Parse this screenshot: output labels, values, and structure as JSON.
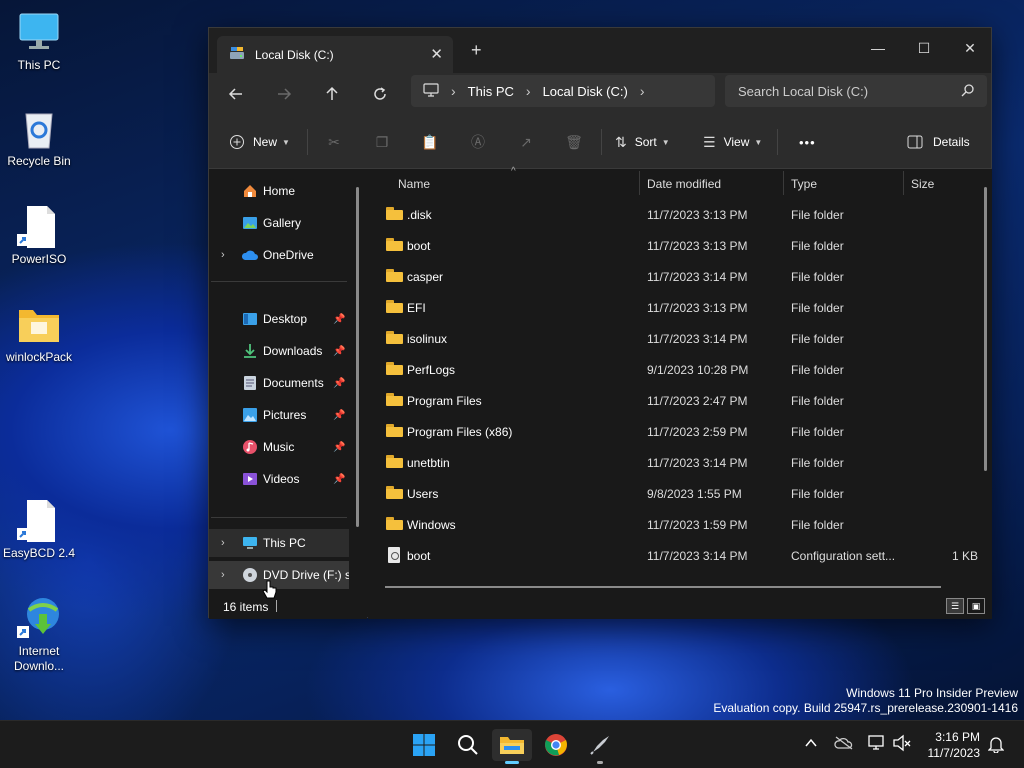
{
  "desktop": {
    "icons": [
      {
        "label": "This PC",
        "icon": "monitor-icon"
      },
      {
        "label": "Recycle Bin",
        "icon": "recycle-bin-icon"
      },
      {
        "label": "PowerISO",
        "icon": "file-shortcut-icon"
      },
      {
        "label": "winlockPack",
        "icon": "folder-icon"
      },
      {
        "label": "EasyBCD 2.4",
        "icon": "file-shortcut-icon"
      },
      {
        "label": "Internet",
        "label2": "Downlo...",
        "icon": "idm-icon"
      }
    ],
    "watermark": {
      "line1": "Windows 11 Pro Insider Preview",
      "line2": "Evaluation copy. Build 25947.rs_prerelease.230901-1416"
    }
  },
  "explorer": {
    "tab_title": "Local Disk (C:)",
    "breadcrumb": [
      "This PC",
      "Local Disk (C:)"
    ],
    "search_placeholder": "Search Local Disk (C:)",
    "toolbar": {
      "new_label": "New",
      "sort_label": "Sort",
      "view_label": "View",
      "more_label": "•••",
      "details_label": "Details"
    },
    "nav": {
      "home": "Home",
      "gallery": "Gallery",
      "onedrive": "OneDrive",
      "desktop": "Desktop",
      "downloads": "Downloads",
      "documents": "Documents",
      "pictures": "Pictures",
      "music": "Music",
      "videos": "Videos",
      "thispc": "This PC",
      "dvd": "DVD Drive (F:) sl"
    },
    "columns": {
      "name": "Name",
      "date": "Date modified",
      "type": "Type",
      "size": "Size"
    },
    "rows": [
      {
        "name": ".disk",
        "date": "11/7/2023 3:13 PM",
        "type": "File folder",
        "size": ""
      },
      {
        "name": "boot",
        "date": "11/7/2023 3:13 PM",
        "type": "File folder",
        "size": ""
      },
      {
        "name": "casper",
        "date": "11/7/2023 3:14 PM",
        "type": "File folder",
        "size": ""
      },
      {
        "name": "EFI",
        "date": "11/7/2023 3:13 PM",
        "type": "File folder",
        "size": ""
      },
      {
        "name": "isolinux",
        "date": "11/7/2023 3:14 PM",
        "type": "File folder",
        "size": ""
      },
      {
        "name": "PerfLogs",
        "date": "9/1/2023 10:28 PM",
        "type": "File folder",
        "size": ""
      },
      {
        "name": "Program Files",
        "date": "11/7/2023 2:47 PM",
        "type": "File folder",
        "size": ""
      },
      {
        "name": "Program Files (x86)",
        "date": "11/7/2023 2:59 PM",
        "type": "File folder",
        "size": ""
      },
      {
        "name": "unetbtin",
        "date": "11/7/2023 3:14 PM",
        "type": "File folder",
        "size": ""
      },
      {
        "name": "Users",
        "date": "9/8/2023 1:55 PM",
        "type": "File folder",
        "size": ""
      },
      {
        "name": "Windows",
        "date": "11/7/2023 1:59 PM",
        "type": "File folder",
        "size": ""
      },
      {
        "name": "boot",
        "date": "11/7/2023 3:14 PM",
        "type": "Configuration sett...",
        "size": "1 KB"
      }
    ],
    "status": "16 items"
  },
  "taskbar": {
    "time": "3:16 PM",
    "date": "11/7/2023"
  },
  "colors": {
    "folder": "#f5c03c",
    "window_bg": "#191919",
    "toolbar_bg": "#2c2c2c"
  }
}
